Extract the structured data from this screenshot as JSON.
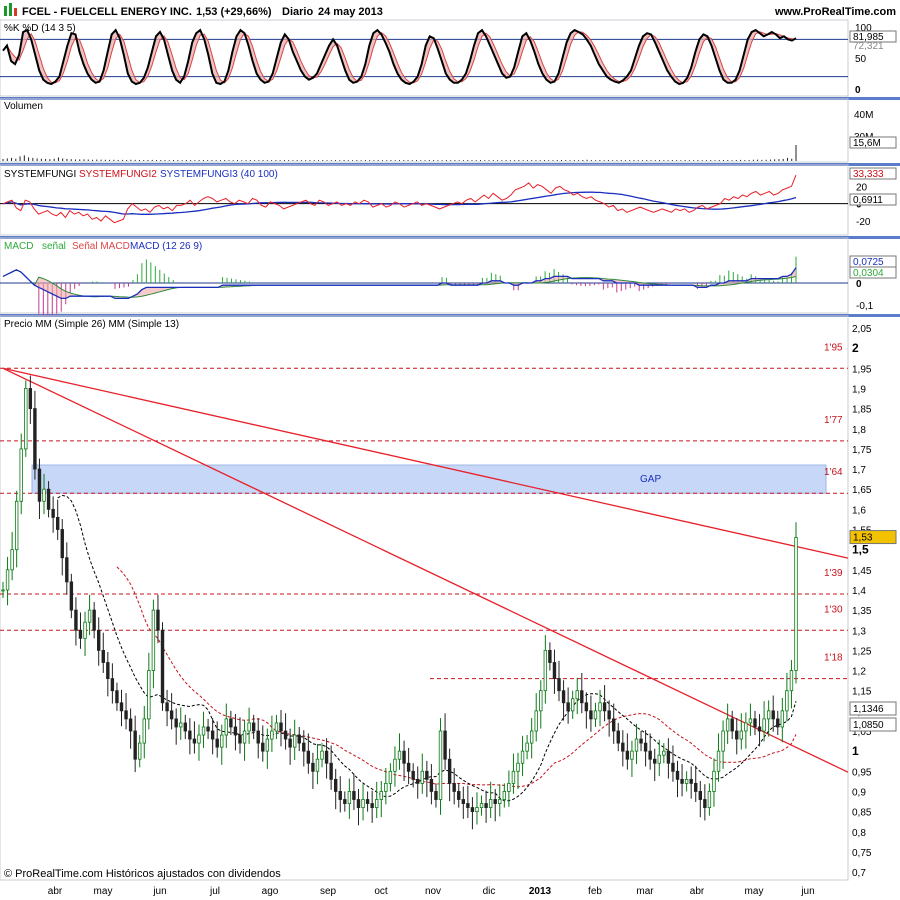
{
  "header": {
    "ticker": "FCEL - FUELCELL ENERGY INC.",
    "quote": "1,53 (+29,66%)",
    "period": "Diario",
    "date": "24 may 2013",
    "site": "www.ProRealTime.com"
  },
  "footer": {
    "credit": "© ProRealTime.com Históricos ajustados con dividendos"
  },
  "colors": {
    "background": "#ffffff",
    "panel_border": "#c8cdd5",
    "separator": "#5b7cc9",
    "up_candle": "#0a7a14",
    "down_candle": "#222222",
    "trendline": "#e8202a",
    "level_line": "#c8141e",
    "gap_zone": "#c7d7f7",
    "last_price_tag": "#f2c200"
  },
  "chart_data": [
    {
      "type": "line",
      "panel": "stochastic",
      "title": "%K %D (14 3 5)",
      "series": [
        {
          "name": "%K"
        },
        {
          "name": "%D"
        }
      ],
      "ylim": [
        0,
        100
      ],
      "tick_labels": [
        "100",
        "50",
        "0"
      ],
      "reference_lines": [
        80,
        20
      ],
      "last_values": [
        "81,985",
        "72,321"
      ],
      "values": [
        62,
        70,
        45,
        40,
        55,
        92,
        95,
        80,
        55,
        30,
        15,
        10,
        8,
        12,
        20,
        45,
        70,
        90,
        88,
        60,
        40,
        25,
        15,
        10,
        12,
        30,
        60,
        88,
        95,
        82,
        55,
        25,
        12,
        8,
        10,
        18,
        35,
        60,
        85,
        92,
        80,
        55,
        30,
        15,
        10,
        20,
        45,
        75,
        90,
        95,
        80,
        55,
        25,
        10,
        8,
        12,
        30,
        60,
        85,
        95,
        90,
        70,
        45,
        25,
        15,
        10,
        12,
        25,
        50,
        75,
        88,
        80,
        60,
        45,
        30,
        20,
        15,
        18,
        25,
        40,
        55,
        70,
        80,
        70,
        50,
        30,
        15,
        10,
        12,
        20,
        40,
        70,
        90,
        95,
        88,
        75,
        60,
        40,
        25,
        15,
        10,
        8,
        12,
        20,
        40,
        70,
        85,
        82,
        65,
        45,
        25,
        15,
        10,
        10,
        15,
        25,
        45,
        70,
        90,
        95,
        85,
        70,
        55,
        40,
        25,
        18,
        20,
        35,
        60,
        85,
        90,
        78,
        60,
        40,
        25,
        15,
        10,
        12,
        25,
        50,
        75,
        90,
        95,
        92,
        88,
        80,
        70,
        55,
        40,
        30,
        20,
        15,
        12,
        10,
        14,
        20,
        30,
        50,
        70,
        85,
        90,
        88,
        75,
        60,
        45,
        30,
        20,
        12,
        8,
        10,
        18,
        35,
        60,
        80,
        88,
        85,
        70,
        50,
        30,
        15,
        10,
        10,
        15,
        30,
        55,
        80,
        92,
        95,
        90,
        85,
        88,
        92,
        88,
        82,
        85,
        80,
        78,
        82
      ]
    },
    {
      "type": "bar",
      "panel": "volume",
      "title": "Volumen",
      "tick_labels": [
        "40M",
        "30M"
      ],
      "last_value": "15,6M",
      "values": [
        2.0,
        2.5,
        3.0,
        2.2,
        4.5,
        5.5,
        3.5,
        3.0,
        2.5,
        2.2,
        2.0,
        1.8,
        2.2,
        3.5,
        2.5,
        2.0,
        1.8,
        1.5,
        1.5,
        1.6,
        1.4,
        1.2,
        1.4,
        1.3,
        1.2,
        1.1,
        1.2,
        1.0,
        1.1,
        1.0,
        1.2,
        1.1,
        1.0,
        0.9,
        1.0,
        1.1,
        0.9,
        1.0,
        0.9,
        0.8,
        1.0,
        0.9,
        0.8,
        1.0,
        0.9,
        0.8,
        0.9,
        1.0,
        0.8,
        0.9,
        0.8,
        0.8,
        0.9,
        0.8,
        0.8,
        0.9,
        0.8,
        0.8,
        0.9,
        0.8,
        0.8,
        0.9,
        0.8,
        0.8,
        0.9,
        0.8,
        0.9,
        0.8,
        0.8,
        0.9,
        0.8,
        0.8,
        0.9,
        0.8,
        0.8,
        0.9,
        0.8,
        0.8,
        0.9,
        0.8,
        0.9,
        0.8,
        0.8,
        0.9,
        0.8,
        0.9,
        0.8,
        0.8,
        0.9,
        0.8,
        0.8,
        0.9,
        0.8,
        0.8,
        0.9,
        0.8,
        0.8,
        0.9,
        0.8,
        0.8,
        0.9,
        0.9,
        0.8,
        0.8,
        0.9,
        0.8,
        0.9,
        0.8,
        0.8,
        0.9,
        0.8,
        0.8,
        0.9,
        0.8,
        0.8,
        0.9,
        0.8,
        0.8,
        0.9,
        0.8,
        0.8,
        0.9,
        0.8,
        0.8,
        0.9,
        0.8,
        0.8,
        0.9,
        0.8,
        0.8,
        0.9,
        1.0,
        0.9,
        0.8,
        0.9,
        0.8,
        1.0,
        1.2,
        0.9,
        0.8,
        0.9,
        0.8,
        0.9,
        0.8,
        0.8,
        0.9,
        0.8,
        0.8,
        0.9,
        0.8,
        0.8,
        0.9,
        0.8,
        0.8,
        0.9,
        0.8,
        0.8,
        0.9,
        0.8,
        0.8,
        0.9,
        0.8,
        0.8,
        0.9,
        0.8,
        0.8,
        0.9,
        0.8,
        0.9,
        1.0,
        0.9,
        0.8,
        1.0,
        1.1,
        0.9,
        1.0,
        1.2,
        1.3,
        1.1,
        1.2,
        1.4,
        1.6,
        1.8,
        2.0,
        3.0,
        2.2,
        15.6
      ]
    },
    {
      "type": "line",
      "panel": "systemfungi",
      "title": "SYSTEMFUNGI SYSTEMFUNGI2 SYSTEMFUNGI3 (40 100)",
      "series": [
        {
          "name": "SYSTEMFUNGI"
        },
        {
          "name": "SYSTEMFUNGI2"
        },
        {
          "name": "SYSTEMFUNGI3"
        }
      ],
      "ylim": [
        -20,
        40
      ],
      "tick_labels": [
        "20",
        "0",
        "-20"
      ],
      "last_values": [
        "33,333",
        "0,6911"
      ],
      "red_values": [
        0,
        2,
        4,
        -5,
        -8,
        4,
        2,
        -6,
        -12,
        -10,
        -8,
        -12,
        -14,
        -10,
        -16,
        -8,
        -12,
        -10,
        -14,
        -12,
        -18,
        -16,
        -20,
        -14,
        -18,
        -22,
        -20,
        -18,
        -6,
        0,
        -4,
        -8,
        -6,
        -10,
        -4,
        -2,
        -6,
        -4,
        -8,
        -2,
        -2,
        0,
        4,
        -2,
        2,
        6,
        8,
        6,
        2,
        4,
        6,
        2,
        0,
        4,
        2,
        0,
        6,
        4,
        -2,
        -4,
        2,
        0,
        -2,
        -6,
        -4,
        -2,
        0,
        2,
        4,
        0,
        -2,
        4,
        2,
        -2,
        0,
        2,
        -2,
        0,
        -2,
        2,
        0,
        4,
        2,
        -4,
        -2,
        0,
        -4,
        -2,
        2,
        0,
        -4,
        -2,
        0,
        2,
        -2,
        0,
        -2,
        -4,
        -6,
        -4,
        -2,
        0,
        2,
        0,
        4,
        6,
        2,
        6,
        10,
        6,
        12,
        8,
        4,
        6,
        10,
        16,
        18,
        20,
        24,
        18,
        22,
        20,
        16,
        12,
        18,
        20,
        16,
        14,
        10,
        12,
        8,
        6,
        8,
        4,
        2,
        0,
        -4,
        -2,
        -8,
        -6,
        -10,
        -8,
        -6,
        -4,
        -6,
        -8,
        -10,
        -8,
        -6,
        -8,
        -10,
        -6,
        -8,
        -6,
        -10,
        -8,
        -4,
        -2,
        -6,
        -4,
        -2,
        0,
        6,
        4,
        8,
        6,
        10,
        8,
        12,
        14,
        10,
        12,
        14,
        10,
        12,
        16,
        18,
        20,
        33
      ]
    },
    {
      "type": "line",
      "panel": "macd",
      "title": "MACD señal Señal MACD (12 26 9)",
      "series": [
        {
          "name": "MACD"
        },
        {
          "name": "señal"
        },
        {
          "name": "Señal MACD"
        }
      ],
      "ylim": [
        -0.1,
        0.1
      ],
      "tick_labels": [
        "0",
        "-0,1"
      ],
      "last_values": [
        "0,0725",
        "0,0304"
      ],
      "values": [
        0.03,
        0.04,
        0.05,
        0.06,
        0.05,
        0.03,
        0.01,
        -0.01,
        -0.02,
        -0.03,
        -0.04,
        -0.05,
        -0.06,
        -0.07,
        -0.07,
        -0.06,
        -0.06,
        -0.06,
        -0.06,
        -0.06,
        -0.06,
        -0.06,
        -0.06,
        -0.06,
        -0.06,
        -0.07,
        -0.07,
        -0.07,
        -0.07,
        -0.06,
        -0.05,
        -0.03,
        -0.02,
        -0.02,
        -0.02,
        -0.02,
        -0.02,
        -0.02,
        -0.02,
        -0.02,
        -0.02,
        -0.02,
        -0.02,
        -0.02,
        -0.02,
        -0.02,
        -0.02,
        -0.02,
        -0.02,
        -0.01,
        -0.01,
        -0.01,
        -0.01,
        -0.01,
        -0.01,
        -0.01,
        -0.01,
        -0.01,
        -0.01,
        -0.01,
        -0.01,
        -0.01,
        -0.01,
        -0.01,
        -0.01,
        -0.01,
        -0.01,
        -0.01,
        -0.01,
        -0.01,
        -0.01,
        -0.01,
        -0.01,
        -0.01,
        -0.01,
        -0.01,
        -0.01,
        -0.01,
        -0.01,
        -0.01,
        -0.01,
        -0.01,
        -0.01,
        -0.01,
        -0.01,
        -0.01,
        -0.01,
        -0.01,
        -0.01,
        -0.01,
        -0.01,
        -0.01,
        -0.01,
        -0.01,
        -0.01,
        -0.01,
        -0.01,
        -0.01,
        0.0,
        0.0,
        -0.01,
        -0.01,
        -0.01,
        -0.01,
        -0.01,
        -0.01,
        -0.01,
        0.0,
        0.0,
        0.01,
        0.01,
        0.01,
        0.0,
        0.0,
        -0.01,
        -0.01,
        0.0,
        0.0,
        0.0,
        0.01,
        0.01,
        0.02,
        0.02,
        0.03,
        0.03,
        0.03,
        0.03,
        0.02,
        0.02,
        0.02,
        0.02,
        0.02,
        0.02,
        0.02,
        0.01,
        0.01,
        0.01,
        0.0,
        0.0,
        0.0,
        0.0,
        0.0,
        -0.01,
        -0.01,
        -0.01,
        -0.01,
        -0.01,
        -0.01,
        -0.01,
        -0.01,
        -0.01,
        -0.01,
        -0.01,
        -0.01,
        -0.01,
        -0.02,
        -0.02,
        -0.02,
        -0.01,
        -0.01,
        0.0,
        0.0,
        0.01,
        0.01,
        0.01,
        0.01,
        0.01,
        0.02,
        0.02,
        0.02,
        0.02,
        0.02,
        0.02,
        0.02,
        0.03,
        0.03,
        0.04,
        0.07
      ]
    },
    {
      "type": "line",
      "panel": "price",
      "title": "Precio MM (Simple 26) MM (Simple 13)",
      "series": [
        {
          "name": "Precio"
        },
        {
          "name": "MM (Simple 26)"
        },
        {
          "name": "MM (Simple 13)"
        }
      ],
      "ylim": [
        0.7,
        2.05
      ],
      "y_ticks": [
        "2,05",
        "2",
        "1,95",
        "1,9",
        "1,85",
        "1,8",
        "1,75",
        "1,7",
        "1,65",
        "1,6",
        "1,55",
        "1,5",
        "1,45",
        "1,4",
        "1,35",
        "1,3",
        "1,25",
        "1,2",
        "1,15",
        "1,1",
        "1,05",
        "1",
        "0,95",
        "0,9",
        "0,85",
        "0,8",
        "0,75",
        "0,7"
      ],
      "x_ticks": [
        "abr",
        "may",
        "jun",
        "jul",
        "ago",
        "sep",
        "oct",
        "nov",
        "dic",
        "2013",
        "feb",
        "mar",
        "abr",
        "may",
        "jun"
      ],
      "levels": [
        {
          "value": 1.95,
          "label": "1'95"
        },
        {
          "value": 1.77,
          "label": "1'77"
        },
        {
          "value": 1.64,
          "label": "1'64"
        },
        {
          "value": 1.39,
          "label": "1'39"
        },
        {
          "value": 1.3,
          "label": "1'30"
        },
        {
          "value": 1.18,
          "label": "1'18"
        }
      ],
      "gap_zone": {
        "from": 1.64,
        "to": 1.71,
        "label": "GAP"
      },
      "value_tags": [
        {
          "value": 1.53,
          "label": "1,53",
          "highlight": true
        },
        {
          "value": 1.1346,
          "label": "1,1346",
          "highlight": false
        },
        {
          "value": 1.085,
          "label": "1,0850",
          "highlight": false
        }
      ],
      "trendlines": [
        {
          "x": [
            0,
            185
          ],
          "y": [
            1.95,
            1.48
          ]
        },
        {
          "x": [
            0,
            185
          ],
          "y": [
            1.95,
            0.95
          ]
        }
      ],
      "close": [
        1.4,
        1.45,
        1.5,
        1.62,
        1.75,
        1.9,
        1.85,
        1.7,
        1.62,
        1.65,
        1.6,
        1.58,
        1.55,
        1.48,
        1.42,
        1.35,
        1.3,
        1.28,
        1.32,
        1.35,
        1.3,
        1.25,
        1.22,
        1.18,
        1.15,
        1.12,
        1.1,
        1.08,
        1.05,
        0.98,
        1.02,
        1.08,
        1.2,
        1.35,
        1.3,
        1.12,
        1.1,
        1.08,
        1.06,
        1.07,
        1.05,
        1.03,
        1.02,
        1.04,
        1.06,
        1.05,
        1.03,
        1.01,
        1.04,
        1.08,
        1.06,
        1.04,
        1.02,
        1.05,
        1.07,
        1.05,
        1.02,
        1.0,
        1.03,
        1.05,
        1.07,
        1.05,
        1.03,
        1.01,
        1.04,
        1.02,
        1.0,
        0.97,
        0.95,
        0.98,
        1.0,
        0.97,
        0.93,
        0.9,
        0.88,
        0.87,
        0.9,
        0.88,
        0.86,
        0.88,
        0.87,
        0.86,
        0.88,
        0.9,
        0.92,
        0.95,
        0.98,
        1.0,
        0.97,
        0.95,
        0.93,
        0.92,
        0.95,
        0.93,
        0.9,
        0.88,
        1.05,
        0.98,
        0.92,
        0.9,
        0.88,
        0.87,
        0.86,
        0.85,
        0.86,
        0.87,
        0.86,
        0.88,
        0.87,
        0.88,
        0.9,
        0.92,
        0.95,
        0.97,
        1.0,
        1.02,
        1.05,
        1.1,
        1.15,
        1.25,
        1.22,
        1.18,
        1.15,
        1.12,
        1.1,
        1.13,
        1.15,
        1.12,
        1.1,
        1.08,
        1.1,
        1.12,
        1.1,
        1.08,
        1.05,
        1.02,
        1.0,
        0.98,
        1.0,
        1.03,
        1.02,
        1.0,
        0.98,
        0.97,
        0.99,
        1.0,
        0.97,
        0.95,
        0.93,
        0.92,
        0.93,
        0.92,
        0.9,
        0.88,
        0.86,
        0.9,
        0.95,
        1.0,
        1.05,
        1.08,
        1.05,
        1.03,
        1.05,
        1.07,
        1.08,
        1.06,
        1.05,
        1.08,
        1.1,
        1.08,
        1.06,
        1.1,
        1.15,
        1.2,
        1.53
      ]
    }
  ]
}
